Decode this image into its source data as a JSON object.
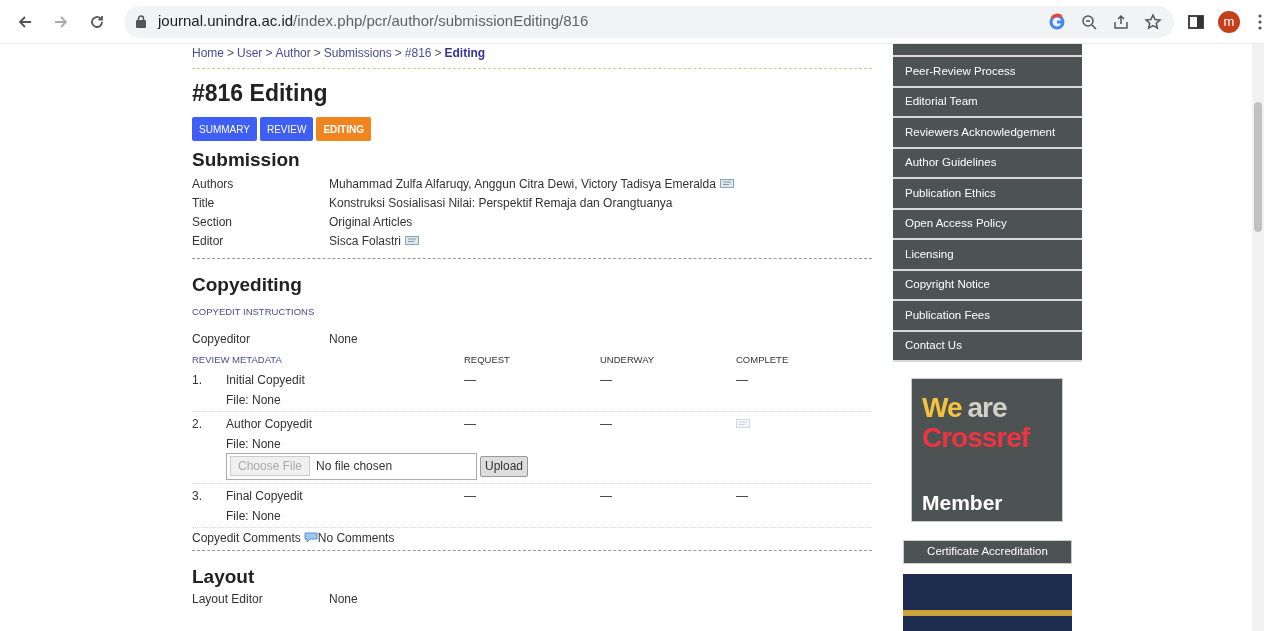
{
  "browser": {
    "url_host": "journal.unindra.ac.id",
    "url_path": "/index.php/pcr/author/submissionEditing/816",
    "avatar": "m"
  },
  "breadcrumb": [
    {
      "label": "Home",
      "current": false
    },
    {
      "label": "User",
      "current": false
    },
    {
      "label": "Author",
      "current": false
    },
    {
      "label": "Submissions",
      "current": false
    },
    {
      "label": "#816",
      "current": false
    },
    {
      "label": "Editing",
      "current": true
    }
  ],
  "breadcrumb_separator": ">",
  "page_title": "#816 Editing",
  "tabs": [
    {
      "label": "SUMMARY",
      "selected": false
    },
    {
      "label": "REVIEW",
      "selected": false
    },
    {
      "label": "EDITING",
      "selected": true
    }
  ],
  "submission": {
    "heading": "Submission",
    "fields": [
      {
        "label": "Authors",
        "value": "Muhammad Zulfa Alfaruqy, Anggun Citra Dewi, Victory Tadisya Emeralda",
        "email_icon": true
      },
      {
        "label": "Title",
        "value": "Konstruksi Sosialisasi Nilai: Perspektif Remaja dan Orangtuanya",
        "email_icon": false
      },
      {
        "label": "Section",
        "value": "Original Articles",
        "email_icon": false
      },
      {
        "label": "Editor",
        "value": "Sisca Folastri",
        "email_icon": true
      }
    ]
  },
  "copyediting": {
    "heading": "Copyediting",
    "instructions_link": "COPYEDIT INSTRUCTIONS",
    "copyeditor_label": "Copyeditor",
    "copyeditor_value": "None",
    "metadata_link": "REVIEW METADATA",
    "columns": [
      "REQUEST",
      "UNDERWAY",
      "COMPLETE"
    ],
    "rows": [
      {
        "number": "1.",
        "name": "Initial Copyedit",
        "request": "—",
        "underway": "—",
        "complete": {
          "kind": "text",
          "text": "—"
        },
        "file": "File: None",
        "upload": null
      },
      {
        "number": "2.",
        "name": "Author Copyedit",
        "request": "—",
        "underway": "—",
        "complete": {
          "kind": "email-icon"
        },
        "file": "File: None",
        "upload": {
          "choose_button": "Choose File",
          "placeholder": "No file chosen",
          "button": "Upload",
          "disabled": true
        }
      },
      {
        "number": "3.",
        "name": "Final Copyedit",
        "request": "—",
        "underway": "—",
        "complete": {
          "kind": "text",
          "text": "—"
        },
        "file": "File: None",
        "upload": null
      }
    ],
    "comments_label": "Copyedit Comments",
    "comments_value": "No Comments"
  },
  "layout": {
    "heading": "Layout",
    "editor_label": "Layout Editor",
    "editor_value": "None"
  },
  "sidebar": {
    "menu": [
      "Peer-Review Process",
      "Editorial Team",
      "Reviewers Acknowledgement",
      "Author Guidelines",
      "Publication Ethics",
      "Open Access Policy",
      "Licensing",
      "Copyright Notice",
      "Publication Fees",
      "Contact Us"
    ],
    "crossref": {
      "line1_a": "We",
      "line1_b": "are",
      "line2": "Crossref",
      "line3": "Member"
    },
    "certificate_button": "Certificate Accreditation"
  }
}
